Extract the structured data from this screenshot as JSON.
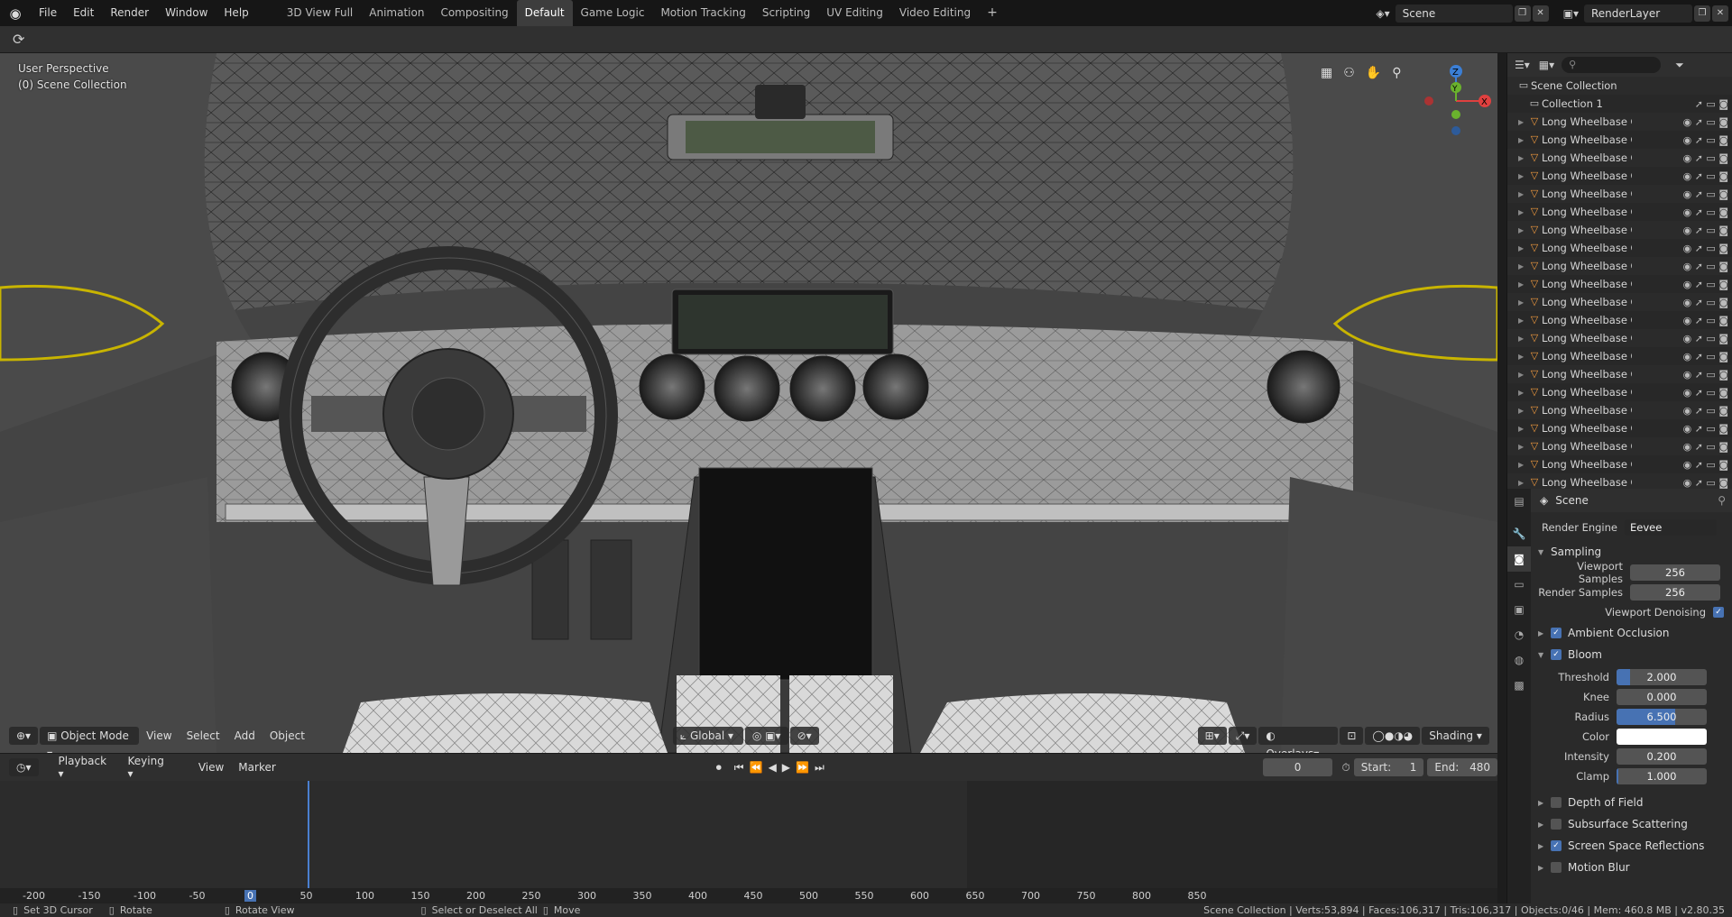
{
  "menu": {
    "items": [
      "File",
      "Edit",
      "Render",
      "Window",
      "Help"
    ]
  },
  "workspaces": {
    "tabs": [
      "3D View Full",
      "Animation",
      "Compositing",
      "Default",
      "Game Logic",
      "Motion Tracking",
      "Scripting",
      "UV Editing",
      "Video Editing"
    ],
    "active": "Default",
    "add": "+"
  },
  "scene": {
    "name": "Scene",
    "layer": "RenderLayer"
  },
  "viewport": {
    "perspective": "User Perspective",
    "collection": "(0) Scene Collection",
    "mode": "Object Mode",
    "menus": [
      "View",
      "Select",
      "Add",
      "Object"
    ],
    "orientation": "Global",
    "overlays": "Overlays",
    "shading": "Shading",
    "gizmo_axes": {
      "z": "Z",
      "y": "Y",
      "x": "X"
    }
  },
  "timeline": {
    "menus": [
      "Playback",
      "Keying",
      "View",
      "Marker"
    ],
    "current_frame": "0",
    "start_label": "Start:",
    "start": "1",
    "end_label": "End:",
    "end": "480",
    "ticks": [
      "-200",
      "-150",
      "-100",
      "-50",
      "0",
      "50",
      "100",
      "150",
      "200",
      "250",
      "300",
      "350",
      "400",
      "450",
      "500",
      "550",
      "600",
      "650",
      "700",
      "750",
      "800",
      "850"
    ],
    "playhead_tick": "0"
  },
  "status": {
    "items": [
      "Set 3D Cursor",
      "Rotate",
      "Rotate View",
      "Select or Deselect All",
      "Move"
    ],
    "info": "Scene Collection | Verts:53,894 | Faces:106,317 | Tris:106,317 | Objects:0/46 | Mem: 460.8 MB | v2.80.35"
  },
  "outliner": {
    "root": "Scene Collection",
    "collection": "Collection 1",
    "objects": [
      "Long Wheelbase Car",
      "Long Wheelbase Car",
      "Long Wheelbase Car",
      "Long Wheelbase Car",
      "Long Wheelbase Car",
      "Long Wheelbase Car",
      "Long Wheelbase Car",
      "Long Wheelbase Car",
      "Long Wheelbase Car",
      "Long Wheelbase Car",
      "Long Wheelbase Car",
      "Long Wheelbase Car",
      "Long Wheelbase Car",
      "Long Wheelbase Car",
      "Long Wheelbase Car",
      "Long Wheelbase Car",
      "Long Wheelbase Car",
      "Long Wheelbase Car",
      "Long Wheelbase Car",
      "Long Wheelbase Car",
      "Long Wheelbase Car"
    ]
  },
  "properties": {
    "context": "Scene",
    "render_engine_label": "Render Engine",
    "render_engine": "Eevee",
    "sampling": "Sampling",
    "viewport_samples_label": "Viewport Samples",
    "viewport_samples": "256",
    "render_samples_label": "Render Samples",
    "render_samples": "256",
    "denoise_label": "Viewport Denoising",
    "ao": "Ambient Occlusion",
    "bloom": "Bloom",
    "threshold_label": "Threshold",
    "threshold": "2.000",
    "knee_label": "Knee",
    "knee": "0.000",
    "radius_label": "Radius",
    "radius": "6.500",
    "color_label": "Color",
    "intensity_label": "Intensity",
    "intensity": "0.200",
    "clamp_label": "Clamp",
    "clamp": "1.000",
    "dof": "Depth of Field",
    "sss": "Subsurface Scattering",
    "ssr": "Screen Space Reflections",
    "motion_blur": "Motion Blur"
  },
  "colors": {
    "accent": "#4772b3",
    "x_axis": "#e0403f",
    "y_axis": "#6ab22d",
    "z_axis": "#3b7fd6",
    "object_icon": "#f09a3e"
  }
}
